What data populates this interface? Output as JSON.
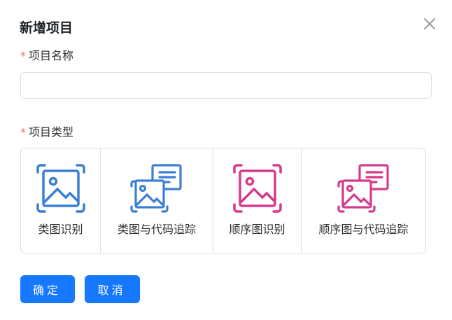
{
  "dialog": {
    "title": "新增项目",
    "name_label": "项目名称",
    "name_value": "",
    "name_placeholder": "",
    "type_label": "项目类型",
    "required_mark": "*",
    "types": [
      {
        "label": "类图识别",
        "icon": "image-frame-icon",
        "color": "#3b7fd4"
      },
      {
        "label": "类图与代码追踪",
        "icon": "image-code-icon",
        "color": "#3b7fd4"
      },
      {
        "label": "顺序图识别",
        "icon": "image-frame-icon",
        "color": "#d63b8a"
      },
      {
        "label": "顺序图与代码追踪",
        "icon": "image-code-icon",
        "color": "#d63b8a"
      }
    ],
    "confirm_label": "确定",
    "cancel_label": "取消"
  },
  "colors": {
    "primary": "#1677ff",
    "required": "#f56c6c",
    "blue_icon": "#3b7fd4",
    "pink_icon": "#d63b8a"
  }
}
